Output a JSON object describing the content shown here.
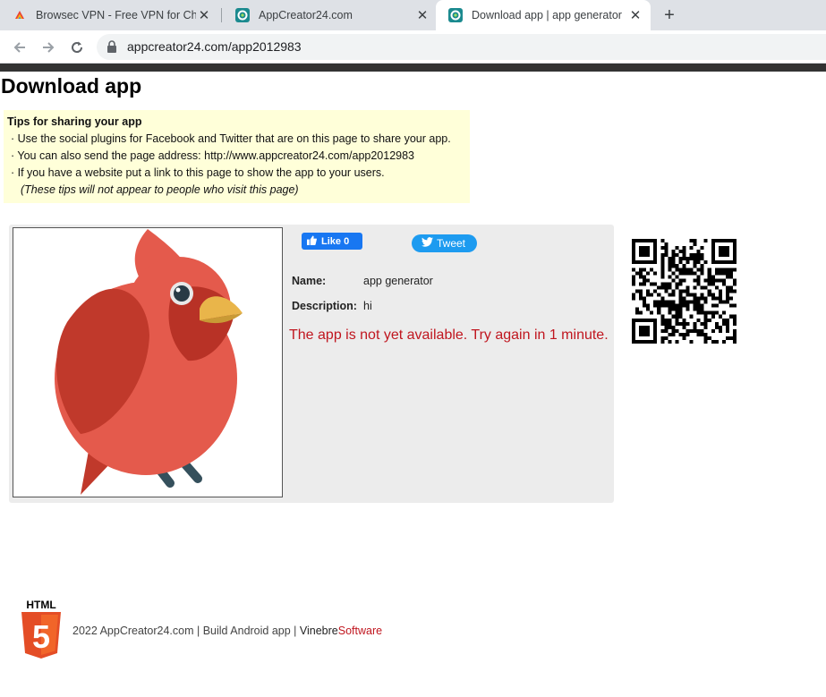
{
  "browser": {
    "tabs": [
      {
        "title": "Browsec VPN - Free VPN for Chro",
        "favicon": "browsec-icon",
        "active": false
      },
      {
        "title": "AppCreator24.com",
        "favicon": "appcreator-icon",
        "active": false
      },
      {
        "title": "Download app | app generator",
        "favicon": "appcreator-icon",
        "active": true
      }
    ],
    "url": "appcreator24.com/app2012983"
  },
  "page": {
    "title": "Download app",
    "tips": {
      "heading": "Tips for sharing your app",
      "items": [
        "· Use the social plugins for Facebook and Twitter that are on this page to share your app.",
        "· You can also send the page address: http://www.appcreator24.com/app2012983",
        "· If you have a website put a link to this page to show the app to your users."
      ],
      "note": "(These tips will not appear to people who visit this page)"
    },
    "social": {
      "like_label": "Like 0",
      "tweet_label": "Tweet"
    },
    "app": {
      "name_label": "Name:",
      "name_value": "app generator",
      "description_label": "Description:",
      "description_value": "hi",
      "status_message": "The app is not yet available. Try again in 1 minute.",
      "image": "cardinal-bird-icon"
    },
    "footer": {
      "badge_text": "HTML",
      "badge_number": "5",
      "text_main": "2022 AppCreator24.com | Build Android app | ",
      "brand_a": "Vinebre",
      "brand_b": "Software"
    }
  },
  "colors": {
    "notice_red": "#c0161f",
    "tips_background": "#ffffd9",
    "facebook_blue": "#1877f2",
    "twitter_blue": "#1d9bf0",
    "panel_gray": "#ececec"
  }
}
